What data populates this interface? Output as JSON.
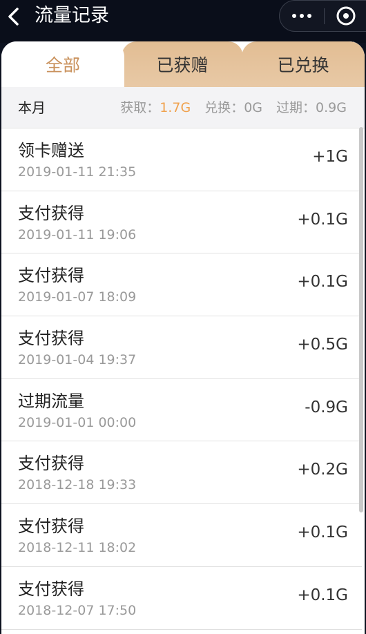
{
  "header": {
    "title": "流量记录",
    "back_icon": "chevron-left-icon",
    "more_icon": "more-dots-icon",
    "close_icon": "close-target-icon"
  },
  "tabs": [
    {
      "label": "全部",
      "active": true
    },
    {
      "label": "已获赠",
      "active": false
    },
    {
      "label": "已兑换",
      "active": false
    }
  ],
  "summary": {
    "period": "本月",
    "obtained_label": "获取：",
    "obtained_value": "1.7G",
    "exchanged_label": "兑换：",
    "exchanged_value": "0G",
    "expired_label": "过期：",
    "expired_value": "0.9G"
  },
  "records": [
    {
      "title": "领卡赠送",
      "time": "2019-01-11 21:35",
      "amount": "+1G"
    },
    {
      "title": "支付获得",
      "time": "2019-01-11 19:06",
      "amount": "+0.1G"
    },
    {
      "title": "支付获得",
      "time": "2019-01-07 18:09",
      "amount": "+0.1G"
    },
    {
      "title": "支付获得",
      "time": "2019-01-04 19:37",
      "amount": "+0.5G"
    },
    {
      "title": "过期流量",
      "time": "2019-01-01 00:00",
      "amount": "-0.9G"
    },
    {
      "title": "支付获得",
      "time": "2018-12-18 19:33",
      "amount": "+0.2G"
    },
    {
      "title": "支付获得",
      "time": "2018-12-11 18:02",
      "amount": "+0.1G"
    },
    {
      "title": "支付获得",
      "time": "2018-12-07 17:50",
      "amount": "+0.1G"
    }
  ],
  "colors": {
    "accent": "#c9915c",
    "highlight": "#f0a24e",
    "tab_inactive_bg": "#e5c39d",
    "topbar_bg": "#0a0e1a"
  }
}
